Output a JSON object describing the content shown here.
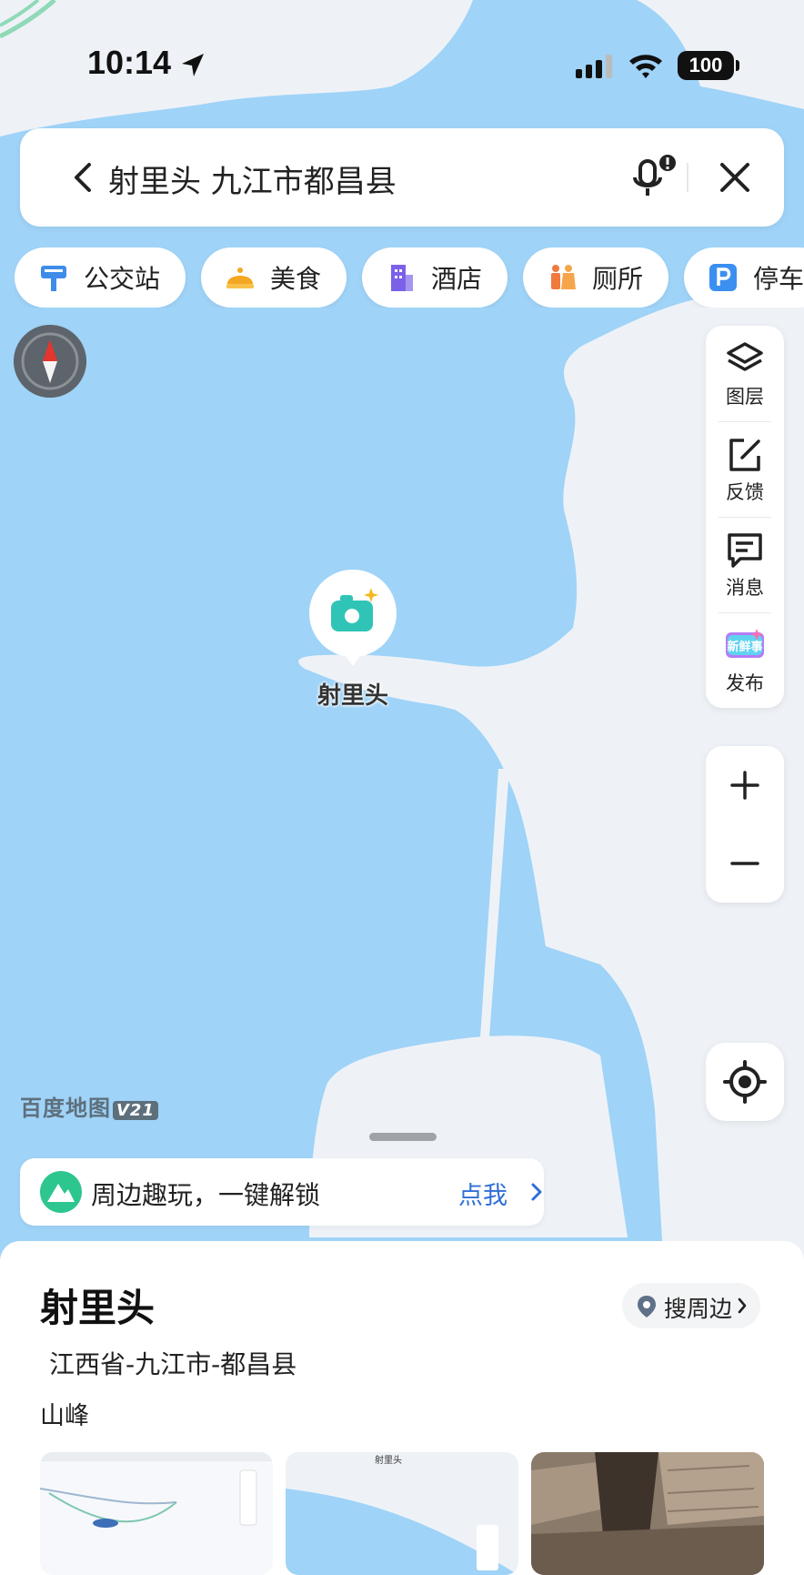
{
  "status_bar": {
    "time": "10:14",
    "battery": "100",
    "icons": [
      "location-arrow-icon",
      "signal-icon",
      "wifi-icon",
      "battery-icon"
    ]
  },
  "search": {
    "query": "射里头 九江市都昌县"
  },
  "categories": [
    {
      "label": "公交站",
      "icon": "bus-stop-icon",
      "color": "#3d8de8"
    },
    {
      "label": "美食",
      "icon": "food-icon",
      "color": "#f5a623"
    },
    {
      "label": "酒店",
      "icon": "hotel-icon",
      "color": "#7b61e8"
    },
    {
      "label": "厕所",
      "icon": "toilet-icon",
      "color": "#f07a3e"
    },
    {
      "label": "停车",
      "icon": "parking-icon",
      "color": "#3b8ff0"
    }
  ],
  "tools": [
    {
      "label": "图层",
      "icon": "layers-icon"
    },
    {
      "label": "反馈",
      "icon": "feedback-icon"
    },
    {
      "label": "消息",
      "icon": "message-icon"
    },
    {
      "label": "发布",
      "icon": "publish-icon",
      "badge": "新鲜事"
    }
  ],
  "map": {
    "marker_label": "射里头",
    "logo": "百度地图",
    "logo_version": "V21",
    "colors": {
      "water": "#9fd3f7",
      "land": "#eef2f7",
      "accent": "#2f6fd6"
    }
  },
  "promo": {
    "text": "周边趣玩，一键解锁",
    "link": "点我"
  },
  "place": {
    "name": "射里头",
    "nearby_button": "搜周边",
    "address": "江西省-九江市-都昌县",
    "category": "山峰",
    "thumbnail_label": "射里头"
  }
}
